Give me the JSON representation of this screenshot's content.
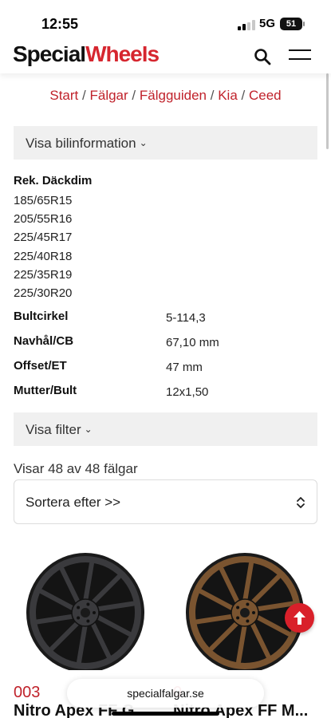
{
  "status_bar": {
    "time": "12:55",
    "network": "5G",
    "battery": "51"
  },
  "header": {
    "logo_part1": "Special",
    "logo_part2": "Wheels"
  },
  "breadcrumb": [
    "Start",
    "Fälgar",
    "Fälgguiden",
    "Kia",
    "Ceed"
  ],
  "breadcrumb_separator": "/",
  "car_info_toggle": "Visa bilinformation",
  "car_info": {
    "tire_label": "Rek. Däckdim",
    "tire_sizes": [
      "185/65R15",
      "205/55R16",
      "225/45R17",
      "225/40R18",
      "225/35R19",
      "225/30R20"
    ],
    "specs": [
      {
        "label": "Bultcirkel",
        "value": "5-114,3"
      },
      {
        "label": "Navhål/CB",
        "value": "67,10 mm"
      },
      {
        "label": "Offset/ET",
        "value": "47 mm"
      },
      {
        "label": "Mutter/Bult",
        "value": "12x1,50"
      }
    ]
  },
  "filter_toggle": "Visa filter",
  "result_count": "Visar 48 av 48 fälgar",
  "sort": {
    "label": "Sortera efter >>"
  },
  "products": [
    {
      "number": "003",
      "name": "Nitro Apex FF G...",
      "color": "#3a3a3d"
    },
    {
      "number": "0",
      "name": "Nitro Apex FF M...",
      "color": "#7a5430"
    }
  ],
  "browser": {
    "url": "specialfalgar.se"
  },
  "colors": {
    "accent": "#d6262f",
    "link": "#c0222b"
  }
}
